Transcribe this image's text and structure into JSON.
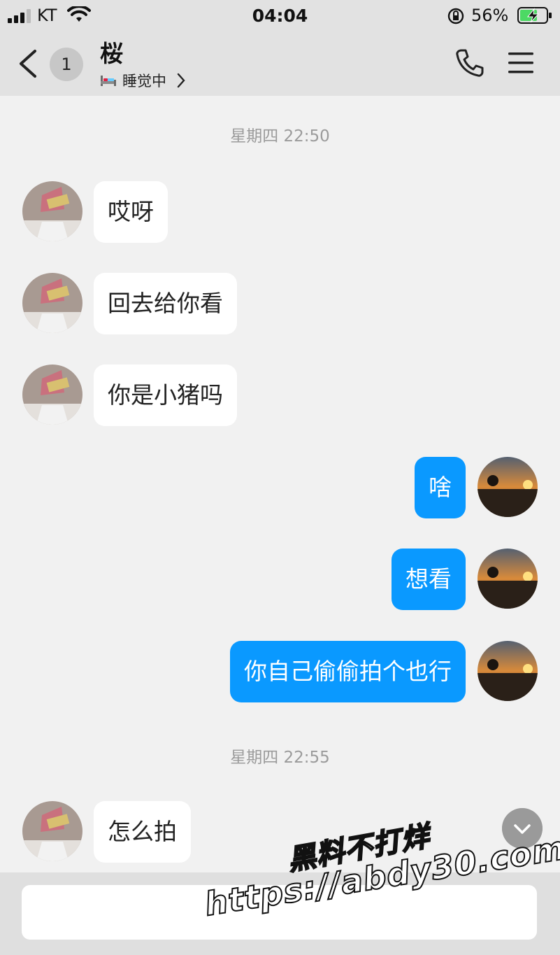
{
  "status_bar": {
    "carrier": "KT",
    "time": "04:04",
    "battery": "56%"
  },
  "header": {
    "unread_count": "1",
    "contact_name": "桜",
    "presence": "睡觉中"
  },
  "messages": [
    {
      "type": "timestamp",
      "text": "星期四 22:50"
    },
    {
      "type": "incoming",
      "text": "哎呀"
    },
    {
      "type": "incoming",
      "text": "回去给你看"
    },
    {
      "type": "incoming",
      "text": "你是小猪吗"
    },
    {
      "type": "outgoing",
      "text": "啥"
    },
    {
      "type": "outgoing",
      "text": "想看"
    },
    {
      "type": "outgoing",
      "text": "你自己偷偷拍个也行"
    },
    {
      "type": "timestamp",
      "text": "星期四 22:55"
    },
    {
      "type": "incoming",
      "text": "怎么拍"
    }
  ],
  "composer": {
    "placeholder": ""
  },
  "watermark": {
    "line1": "黑料不打烊",
    "line2": "https://abdy30.com"
  },
  "colors": {
    "outgoing_bubble": "#0a99ff",
    "incoming_bubble": "#ffffff",
    "header_bg": "#e2e2e2",
    "chat_bg": "#f1f1f1"
  },
  "icons": [
    "signal-icon",
    "wifi-icon",
    "orientation-lock-icon",
    "battery-charging-icon",
    "back-chevron-icon",
    "bed-icon",
    "chevron-right-icon",
    "phone-icon",
    "menu-icon",
    "scroll-down-icon"
  ]
}
